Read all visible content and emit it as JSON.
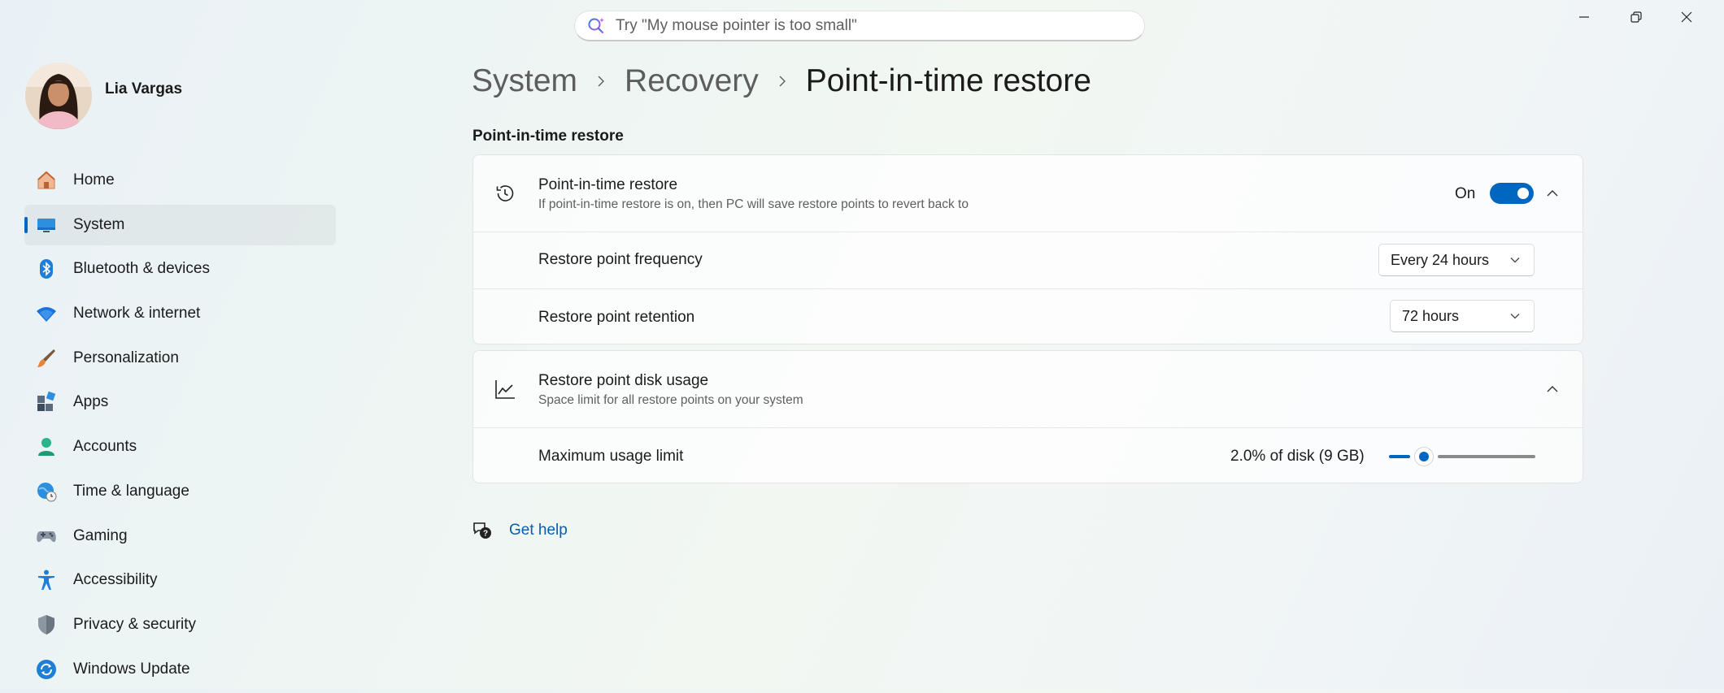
{
  "search": {
    "placeholder": "Try \"My mouse pointer is too small\""
  },
  "profile": {
    "name": "Lia Vargas"
  },
  "sidebar": {
    "items": [
      {
        "label": "Home",
        "icon": "home-icon"
      },
      {
        "label": "System",
        "icon": "system-icon",
        "active": true
      },
      {
        "label": "Bluetooth & devices",
        "icon": "bluetooth-icon"
      },
      {
        "label": "Network & internet",
        "icon": "wifi-icon"
      },
      {
        "label": "Personalization",
        "icon": "brush-icon"
      },
      {
        "label": "Apps",
        "icon": "apps-icon"
      },
      {
        "label": "Accounts",
        "icon": "accounts-icon"
      },
      {
        "label": "Time & language",
        "icon": "globe-clock-icon"
      },
      {
        "label": "Gaming",
        "icon": "gamepad-icon"
      },
      {
        "label": "Accessibility",
        "icon": "accessibility-icon"
      },
      {
        "label": "Privacy & security",
        "icon": "shield-icon"
      },
      {
        "label": "Windows Update",
        "icon": "update-icon"
      }
    ]
  },
  "breadcrumb": {
    "level1": "System",
    "level2": "Recovery",
    "current": "Point-in-time restore"
  },
  "section_title": "Point-in-time restore",
  "restore_card": {
    "title": "Point-in-time restore",
    "subtitle": "If point-in-time restore is on, then PC will save restore points to revert back to",
    "toggle_state": "On",
    "frequency": {
      "label": "Restore point frequency",
      "value": "Every 24 hours"
    },
    "retention": {
      "label": "Restore point retention",
      "value": "72 hours"
    }
  },
  "disk_card": {
    "title": "Restore point disk usage",
    "subtitle": "Space limit for all restore points on your system",
    "max_usage": {
      "label": "Maximum usage limit",
      "value_text": "2.0% of disk (9 GB)",
      "slider_fraction": 0.2
    }
  },
  "help": {
    "label": "Get help"
  },
  "colors": {
    "accent": "#0067c0",
    "link": "#0b5cad"
  }
}
